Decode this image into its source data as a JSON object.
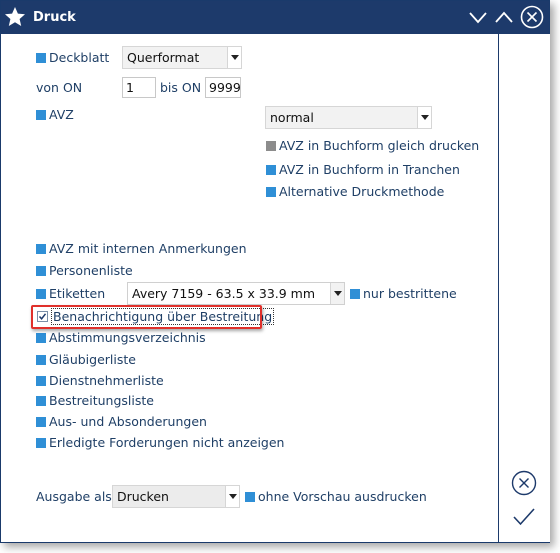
{
  "window": {
    "title": "Druck"
  },
  "deckblatt": {
    "label": "Deckblatt",
    "value": "Querformat"
  },
  "range": {
    "from_label": "von ON",
    "from_value": "1",
    "to_label": "bis ON",
    "to_value": "9999"
  },
  "avz": {
    "label": "AVZ",
    "mode_value": "normal",
    "options": [
      "AVZ in Buchform gleich drucken",
      "AVZ in Buchform in Tranchen",
      "Alternative Druckmethode"
    ]
  },
  "items": {
    "anmerkungen": "AVZ mit internen Anmerkungen",
    "personenliste": "Personenliste",
    "etiketten": "Etiketten",
    "etiketten_value": "Avery 7159 - 63.5 x 33.9 mm",
    "nur_bestrittene": "nur bestrittene",
    "benachrichtigung": "Benachrichtigung über Bestreitung",
    "abstimmung": "Abstimmungsverzeichnis",
    "glaeubiger": "Gläubigerliste",
    "dienstnehmer": "Dienstnehmerliste",
    "bestreitung": "Bestreitungsliste",
    "aussonderung": "Aus- und Absonderungen",
    "erledigte": "Erledigte Forderungen nicht anzeigen"
  },
  "ausgabe": {
    "label": "Ausgabe als :",
    "value": "Drucken",
    "ohne_vorschau": "ohne Vorschau ausdrucken"
  },
  "colors": {
    "titlebar": "#1d3a6b",
    "checkbox": "#2f8fd6",
    "text": "#1f3f66",
    "highlight": "#e0302b"
  },
  "icons": [
    "star-icon",
    "minimize-chevron-icon",
    "maximize-chevron-icon",
    "close-icon",
    "cancel-circle-icon",
    "confirm-check-icon"
  ]
}
